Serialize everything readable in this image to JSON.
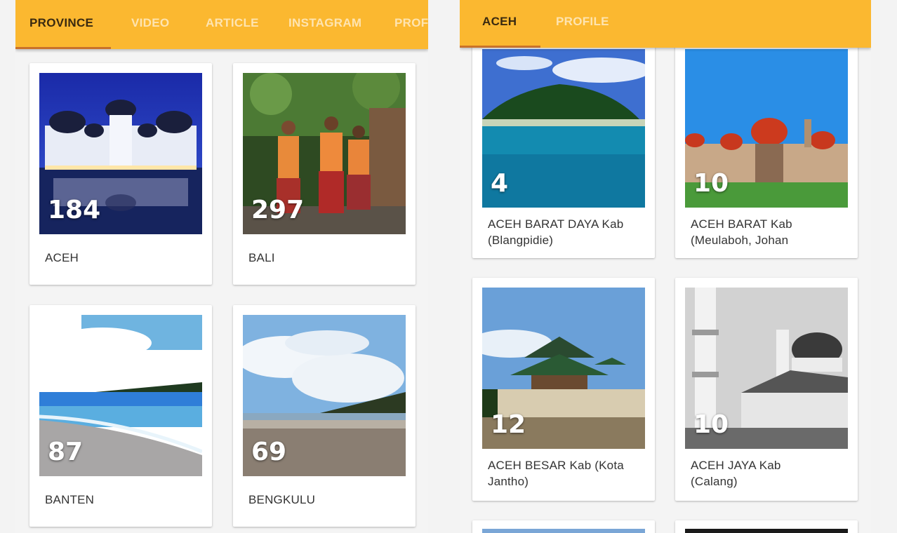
{
  "left_panel": {
    "tabs": [
      {
        "label": "PROVINCE",
        "active": true
      },
      {
        "label": "VIDEO",
        "active": false
      },
      {
        "label": "ARTICLE",
        "active": false
      },
      {
        "label": "INSTAGRAM",
        "active": false
      },
      {
        "label": "PROF",
        "active": false
      }
    ],
    "cards": [
      {
        "name": "ACEH",
        "count": "184",
        "image": "mosque-at-night"
      },
      {
        "name": "BALI",
        "count": "297",
        "image": "dancers-in-forest"
      },
      {
        "name": "BANTEN",
        "count": "87",
        "image": "beach-and-sea"
      },
      {
        "name": "BENGKULU",
        "count": "69",
        "image": "beach-with-clouds"
      }
    ]
  },
  "right_panel": {
    "tabs": [
      {
        "label": "ACEH",
        "active": true
      },
      {
        "label": "PROFILE",
        "active": false
      }
    ],
    "cards": [
      {
        "line1": "ACEH BARAT DAYA Kab",
        "line2": "(Blangpidie)",
        "count": "4",
        "image": "tropical-island"
      },
      {
        "line1": "ACEH BARAT Kab",
        "line2": "(Meulaboh, Johan",
        "count": "10",
        "image": "red-domed-mosque"
      },
      {
        "line1": "ACEH BESAR Kab (Kota",
        "line2": "Jantho)",
        "count": "12",
        "image": "old-wooden-mosque"
      },
      {
        "line1": "ACEH JAYA Kab",
        "line2": "(Calang)",
        "count": "10",
        "image": "grey-mosque-minaret"
      }
    ]
  },
  "colors": {
    "tabbar": "#fbb830",
    "tab_indicator": "#c9722a",
    "tab_active_text": "#3a2a10",
    "card_bg": "#ffffff",
    "page_bg": "#f3f3f3"
  }
}
